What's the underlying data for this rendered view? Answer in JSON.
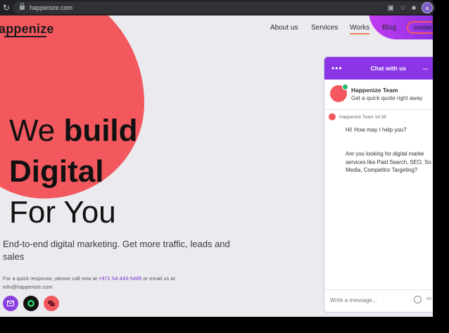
{
  "browser": {
    "url": "happenize.com",
    "profile_initial": "a"
  },
  "site": {
    "logo": "appenize",
    "nav": [
      "About us",
      "Services",
      "Works",
      "Blog"
    ],
    "contact_label": "contac",
    "hero": {
      "line1_a": "We",
      "line1_b": "build",
      "line2": "Digital",
      "line3": "For You"
    },
    "tagline": "End-to-end digital marketing. Get more traffic, leads and sales",
    "quick_response": {
      "prefix": "For a quick response, please call now at",
      "phone": "+971 54-443-5485",
      "middle": "or email us at",
      "email": "info@happenize.com"
    }
  },
  "chat": {
    "title": "Chat with us",
    "team_name": "Happenize Team",
    "team_subtitle": "Get a quick quote right away",
    "message_meta": "Happenize Team 14:39",
    "message1": "Hi! How may I help you?",
    "message2": "Are you looking for digital marke services like Paid Search, SEO, So Media, Competitor Targeting?",
    "input_placeholder": "Write a message..."
  },
  "colors": {
    "accent_red": "#f2585d",
    "accent_purple": "#8b35e6"
  }
}
